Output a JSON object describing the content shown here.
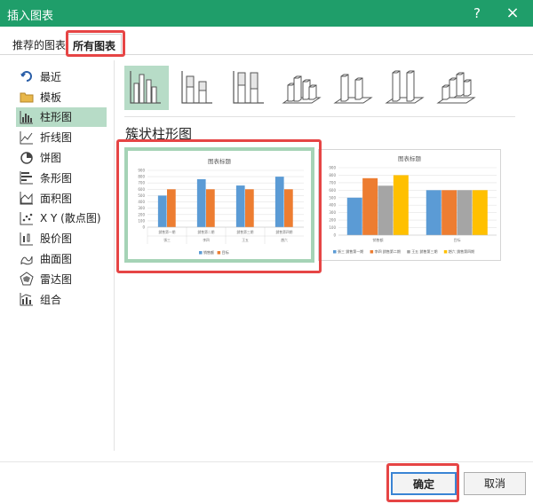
{
  "dialog": {
    "title": "插入图表",
    "help_icon": "?",
    "close_icon": "×"
  },
  "tabs": [
    {
      "label": "推荐的图表"
    },
    {
      "label": "所有图表"
    }
  ],
  "sidebar": {
    "items": [
      {
        "label": "最近",
        "icon": "undo-icon"
      },
      {
        "label": "模板",
        "icon": "folder-icon"
      },
      {
        "label": "柱形图",
        "icon": "column-chart-icon"
      },
      {
        "label": "折线图",
        "icon": "line-chart-icon"
      },
      {
        "label": "饼图",
        "icon": "pie-chart-icon"
      },
      {
        "label": "条形图",
        "icon": "bar-chart-icon"
      },
      {
        "label": "面积图",
        "icon": "area-chart-icon"
      },
      {
        "label": "X Y (散点图)",
        "icon": "scatter-chart-icon"
      },
      {
        "label": "股价图",
        "icon": "stock-chart-icon"
      },
      {
        "label": "曲面图",
        "icon": "surface-chart-icon"
      },
      {
        "label": "雷达图",
        "icon": "radar-chart-icon"
      },
      {
        "label": "组合",
        "icon": "combo-chart-icon"
      }
    ],
    "selected_index": 2
  },
  "subtypes": [
    {
      "icon": "clustered-column-icon"
    },
    {
      "icon": "stacked-column-icon"
    },
    {
      "icon": "100-stacked-column-icon"
    },
    {
      "icon": "3d-clustered-column-icon"
    },
    {
      "icon": "3d-stacked-column-icon"
    },
    {
      "icon": "3d-100-stacked-column-icon"
    },
    {
      "icon": "3d-column-icon"
    }
  ],
  "section_title": "簇状柱形图",
  "colors": {
    "titlebar": "#1f9e6a",
    "selected": "#b7dcc7",
    "highlight": "#e64545",
    "blue": "#5b9bd5",
    "orange": "#ed7d31",
    "gray": "#a5a5a5",
    "yellow": "#ffc000"
  },
  "buttons": {
    "ok": "确定",
    "cancel": "取消"
  },
  "chart_data": [
    {
      "type": "bar",
      "title": "图表标题",
      "categories": [
        "一",
        "二",
        "三",
        "四"
      ],
      "category_labels_row1": [
        "銷售第一期",
        "銷售第二期",
        "銷售第三期",
        "銷售第四期"
      ],
      "category_labels_row2": [
        "張三",
        "李四",
        "王五",
        "趙六"
      ],
      "ylim": [
        0,
        900
      ],
      "yticks": [
        "0",
        "100",
        "200",
        "300",
        "400",
        "500",
        "600",
        "700",
        "800",
        "900"
      ],
      "series": [
        {
          "name": "销售额",
          "color": "#5b9bd5",
          "values": [
            500,
            760,
            660,
            800
          ]
        },
        {
          "name": "目标",
          "color": "#ed7d31",
          "values": [
            600,
            600,
            600,
            600
          ]
        }
      ],
      "legend": "bottom"
    },
    {
      "type": "bar",
      "title": "图表标题",
      "categories": [
        "销售额",
        "目标"
      ],
      "ylim": [
        0,
        900
      ],
      "yticks": [
        "0",
        "100",
        "200",
        "300",
        "400",
        "500",
        "600",
        "700",
        "800",
        "900"
      ],
      "series": [
        {
          "name": "張三 銷售第一期",
          "color": "#5b9bd5",
          "values": [
            500,
            600
          ]
        },
        {
          "name": "李四 銷售第二期",
          "color": "#ed7d31",
          "values": [
            760,
            600
          ]
        },
        {
          "name": "王五 銷售第三期",
          "color": "#a5a5a5",
          "values": [
            660,
            600
          ]
        },
        {
          "name": "趙六 銷售第四期",
          "color": "#ffc000",
          "values": [
            800,
            600
          ]
        }
      ],
      "legend": "bottom"
    }
  ]
}
